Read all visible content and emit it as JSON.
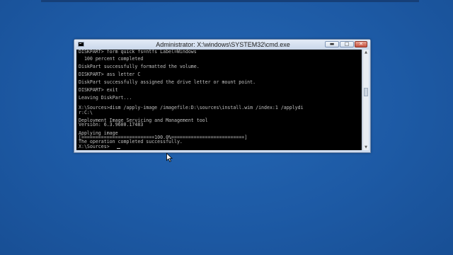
{
  "window": {
    "title": "Administrator: X:\\windows\\SYSTEM32\\cmd.exe",
    "controls": {
      "minimize": "▬",
      "maximize": "□",
      "close": "✕"
    }
  },
  "console": {
    "lines": [
      "DISKPART> form quick fs=ntfs Label=Windows",
      "",
      "  100 percent completed",
      "",
      "DiskPart successfully formatted the volume.",
      "",
      "DISKPART> ass letter C",
      "",
      "DiskPart successfully assigned the drive letter or mount point.",
      "",
      "DISKPART> exit",
      "",
      "Leaving DiskPart...",
      "",
      "X:\\Sources>dism /apply-image /imagefile:D:\\sources\\install.wim /index:1 /applydi",
      "r:C:\\",
      "",
      "Deployment Image Servicing and Management tool",
      "Version: 6.3.9600.17483",
      "",
      "Applying image",
      "[==========================100.0%==========================]",
      "The operation completed successfully.",
      "",
      "X:\\Sources>"
    ]
  },
  "icons": {
    "app": "console-app-icon",
    "pointer": "mouse-pointer-icon"
  },
  "colors": {
    "desktop": "#1f5ba6",
    "console_bg": "#000000",
    "console_text": "#c0c0c0",
    "close_button": "#c7503e"
  }
}
